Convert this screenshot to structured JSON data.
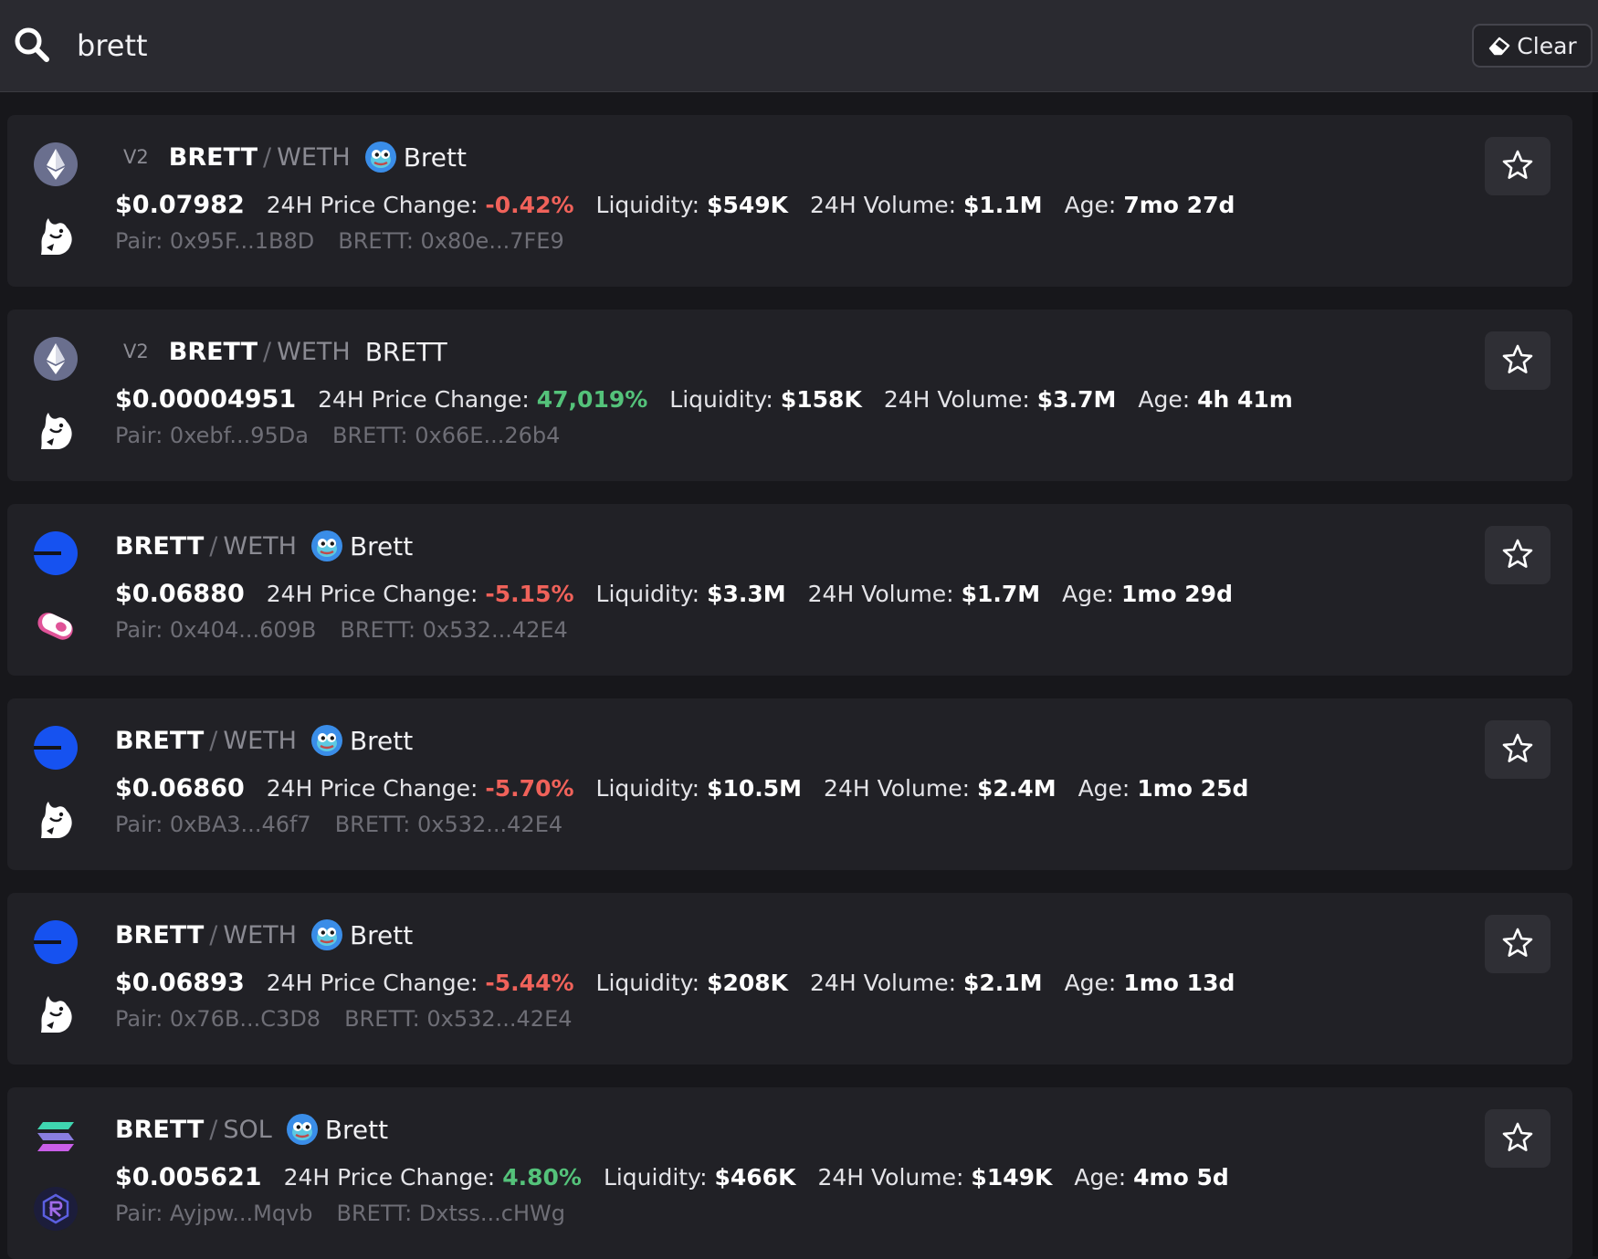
{
  "search": {
    "query": "brett",
    "clear_label": "Clear"
  },
  "colors": {
    "negative": "#f0625a",
    "positive": "#54c27a",
    "muted": "#6e6e76"
  },
  "results": [
    {
      "chain_icon": "ethereum-icon",
      "dex_icon": "uniswap-icon",
      "version": "V2",
      "base": "BRETT",
      "quote": "WETH",
      "token_icon": "brett-pepe-icon",
      "token_name": "Brett",
      "price": "$0.07982",
      "change_label": "24H Price Change:",
      "change": "-0.42%",
      "change_dir": "neg",
      "liquidity_label": "Liquidity:",
      "liquidity": "$549K",
      "volume_label": "24H Volume:",
      "volume": "$1.1M",
      "age_label": "Age:",
      "age": "7mo 27d",
      "pair": "Pair: 0x95F...1B8D",
      "token_addr": "BRETT: 0x80e...7FE9"
    },
    {
      "chain_icon": "ethereum-icon",
      "dex_icon": "uniswap-icon",
      "version": "V2",
      "base": "BRETT",
      "quote": "WETH",
      "token_icon": "",
      "token_name": "BRETT",
      "price": "$0.00004951",
      "change_label": "24H Price Change:",
      "change": "47,019%",
      "change_dir": "pos",
      "liquidity_label": "Liquidity:",
      "liquidity": "$158K",
      "volume_label": "24H Volume:",
      "volume": "$3.7M",
      "age_label": "Age:",
      "age": "4h 41m",
      "pair": "Pair: 0xebf...95Da",
      "token_addr": "BRETT: 0x66E...26b4"
    },
    {
      "chain_icon": "base-chain-icon",
      "dex_icon": "sushiswap-icon",
      "version": "",
      "base": "BRETT",
      "quote": "WETH",
      "token_icon": "brett-pepe-icon",
      "token_name": "Brett",
      "price": "$0.06880",
      "change_label": "24H Price Change:",
      "change": "-5.15%",
      "change_dir": "neg",
      "liquidity_label": "Liquidity:",
      "liquidity": "$3.3M",
      "volume_label": "24H Volume:",
      "volume": "$1.7M",
      "age_label": "Age:",
      "age": "1mo 29d",
      "pair": "Pair: 0x404...609B",
      "token_addr": "BRETT: 0x532...42E4"
    },
    {
      "chain_icon": "base-chain-icon",
      "dex_icon": "uniswap-icon",
      "version": "",
      "base": "BRETT",
      "quote": "WETH",
      "token_icon": "brett-pepe-icon",
      "token_name": "Brett",
      "price": "$0.06860",
      "change_label": "24H Price Change:",
      "change": "-5.70%",
      "change_dir": "neg",
      "liquidity_label": "Liquidity:",
      "liquidity": "$10.5M",
      "volume_label": "24H Volume:",
      "volume": "$2.4M",
      "age_label": "Age:",
      "age": "1mo 25d",
      "pair": "Pair: 0xBA3...46f7",
      "token_addr": "BRETT: 0x532...42E4"
    },
    {
      "chain_icon": "base-chain-icon",
      "dex_icon": "uniswap-icon",
      "version": "",
      "base": "BRETT",
      "quote": "WETH",
      "token_icon": "brett-pepe-icon",
      "token_name": "Brett",
      "price": "$0.06893",
      "change_label": "24H Price Change:",
      "change": "-5.44%",
      "change_dir": "neg",
      "liquidity_label": "Liquidity:",
      "liquidity": "$208K",
      "volume_label": "24H Volume:",
      "volume": "$2.1M",
      "age_label": "Age:",
      "age": "1mo 13d",
      "pair": "Pair: 0x76B...C3D8",
      "token_addr": "BRETT: 0x532...42E4"
    },
    {
      "chain_icon": "solana-icon",
      "dex_icon": "raydium-icon",
      "version": "",
      "base": "BRETT",
      "quote": "SOL",
      "token_icon": "brett-pepe-icon",
      "token_name": "Brett",
      "price": "$0.005621",
      "change_label": "24H Price Change:",
      "change": "4.80%",
      "change_dir": "pos",
      "liquidity_label": "Liquidity:",
      "liquidity": "$466K",
      "volume_label": "24H Volume:",
      "volume": "$149K",
      "age_label": "Age:",
      "age": "4mo 5d",
      "pair": "Pair: Ayjpw...Mqvb",
      "token_addr": "BRETT: Dxtss...cHWg"
    }
  ]
}
